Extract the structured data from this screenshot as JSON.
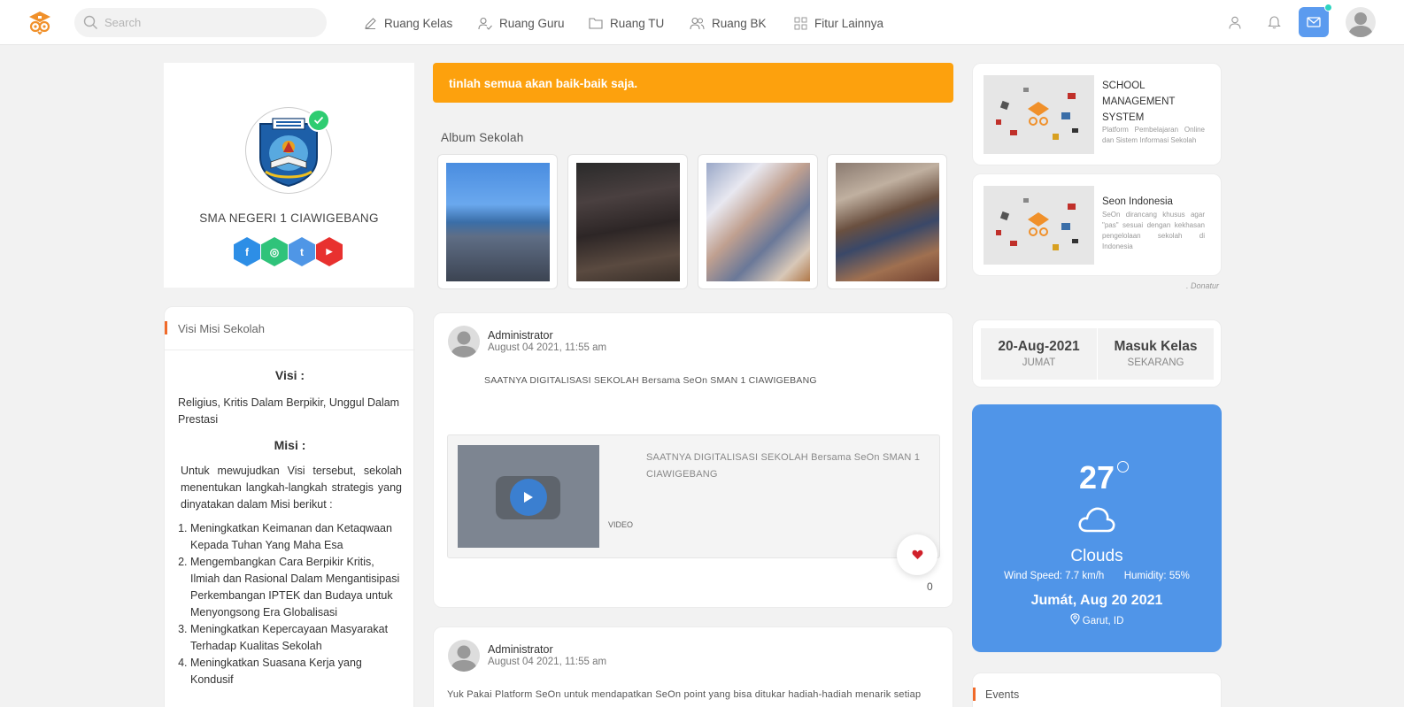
{
  "header": {
    "search_placeholder": "Search",
    "nav": [
      {
        "label": "Ruang Kelas",
        "icon": "pencil-icon"
      },
      {
        "label": "Ruang Guru",
        "icon": "user-check-icon"
      },
      {
        "label": "Ruang TU",
        "icon": "folder-icon"
      },
      {
        "label": "Ruang BK",
        "icon": "users-icon"
      },
      {
        "label": "Fitur Lainnya",
        "icon": "grid-icon"
      }
    ]
  },
  "profile": {
    "school_name": "SMA NEGERI 1 CIAWIGEBANG",
    "socials": [
      {
        "name": "facebook",
        "glyph": "f",
        "color": "#2d8ee6"
      },
      {
        "name": "instagram",
        "glyph": "◎",
        "color": "#2fc37a"
      },
      {
        "name": "twitter",
        "glyph": "t",
        "color": "#4f96e6"
      },
      {
        "name": "youtube",
        "glyph": "▶",
        "color": "#e8312f"
      }
    ]
  },
  "visimisi": {
    "header": "Visi Misi Sekolah",
    "visi_title": "Visi :",
    "visi_text": "Religius, Kritis Dalam Berpikir, Unggul Dalam Prestasi",
    "misi_title": "Misi :",
    "misi_intro": "Untuk mewujudkan Visi tersebut, sekolah menentukan langkah-langkah strategis yang dinyatakan dalam Misi berikut :",
    "misi_items": [
      "Meningkatkan Keimanan dan Ketaqwaan Kepada Tuhan Yang Maha Esa",
      "Mengembangkan Cara Berpikir Kritis, Ilmiah dan Rasional Dalam Mengantisipasi Perkembangan IPTEK dan Budaya untuk Menyongsong Era Globalisasi",
      "Meningkatkan Kepercayaan Masyarakat Terhadap Kualitas Sekolah",
      "Meningkatkan Suasana Kerja yang Kondusif"
    ]
  },
  "alert": {
    "text": "tinlah semua akan baik-baik saja."
  },
  "album": {
    "title": "Album Sekolah"
  },
  "posts": [
    {
      "author": "Administrator",
      "date": "August 04 2021, 11:55 am",
      "text": "SAATNYA DIGITALISASI  SEKOLAH Bersama SeOn SMAN 1 CIAWIGEBANG",
      "video_label": "VIDEO",
      "video_title": "SAATNYA DIGITALISASI  SEKOLAH Bersama SeOn SMAN 1 CIAWIGEBANG",
      "likes": "0"
    },
    {
      "author": "Administrator",
      "date": "August 04 2021, 11:55 am",
      "text": "Yuk Pakai Platform SeOn untuk mendapatkan SeOn point yang bisa ditukar hadiah-hadiah menarik setiap"
    }
  ],
  "ads": [
    {
      "title": "SCHOOL MANAGEMENT SYSTEM",
      "desc": "Platform Pembelajaran Online dan Sistem Informasi Sekolah"
    },
    {
      "title": "Seon Indonesia",
      "desc": "SeOn dirancang khusus agar \"pas\" sesuai dengan kekhasan pengelolaan sekolah di Indonesia"
    }
  ],
  "donatur": ". Donatur",
  "dateinfo": {
    "date": "20-Aug-2021",
    "day": "JUMAT",
    "action": "Masuk Kelas",
    "action_sub": "SEKARANG"
  },
  "weather": {
    "temp": "27",
    "desc": "Clouds",
    "wind": "Wind Speed: 7.7 km/h",
    "humidity": "Humidity: 55%",
    "date": "Jumát, Aug 20 2021",
    "location": "Garut, ID"
  },
  "events": {
    "header": "Events"
  },
  "colors": {
    "accent": "#fda10d",
    "weather_bg": "#5095e8",
    "mail_btn": "#5b9bef",
    "section_bar": "#f06a2a"
  }
}
